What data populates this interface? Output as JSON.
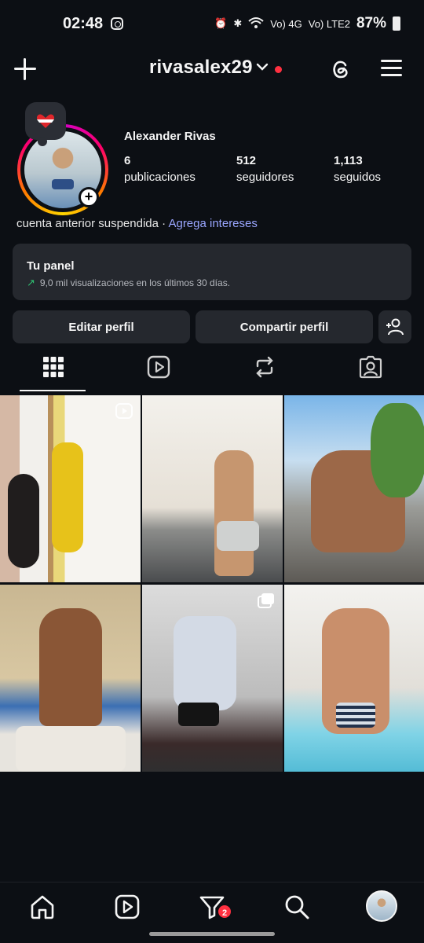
{
  "status_bar": {
    "time": "02:48",
    "network": "Vo) 4G",
    "network2": "Vo) LTE2",
    "battery": "87%"
  },
  "header": {
    "username": "rivasalex29",
    "chevron": "⌄",
    "new_post_icon": "plus-icon",
    "threads_icon": "threads-icon",
    "menu_icon": "hamburger-menu-icon"
  },
  "profile": {
    "full_name": "Alexander Rivas",
    "stats": [
      {
        "value": "6",
        "label": "publicaciones"
      },
      {
        "value": "512",
        "label": "seguidores"
      },
      {
        "value": "1,113",
        "label": "seguidos"
      }
    ],
    "bio_text": "cuenta anterior suspendida · ",
    "bio_link": "Agrega intereses"
  },
  "panel": {
    "title": "Tu panel",
    "arrow": "↗",
    "subtitle": "9,0 mil visualizaciones en los últimos 30 días."
  },
  "buttons": {
    "edit": "Editar perfil",
    "share": "Compartir perfil",
    "add_person_icon": "add-person-icon"
  },
  "tabs": [
    "grid-icon",
    "reels-icon",
    "reposts-icon",
    "tagged-icon"
  ],
  "grid": {
    "post_count": 6
  },
  "bottom_nav": {
    "items": [
      "home-icon",
      "reels-icon",
      "activity-icon",
      "search-icon",
      "profile-avatar"
    ],
    "badge": "2"
  },
  "colors": {
    "background": "#0c0f14",
    "surface": "#25282e",
    "link": "#9aa6ff",
    "notification": "#ff3040",
    "trend_green": "#2fbf71"
  }
}
